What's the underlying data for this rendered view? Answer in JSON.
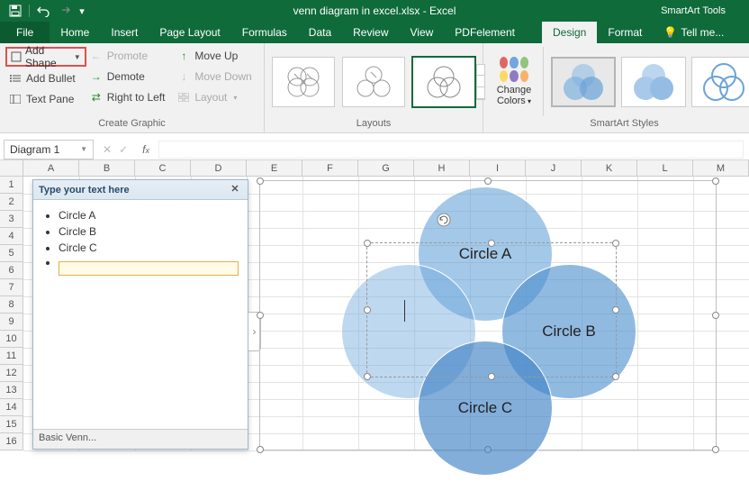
{
  "titlebar": {
    "doc_title": "venn diagram in excel.xlsx - Excel",
    "tool_context": "SmartArt Tools"
  },
  "tabs": {
    "file": "File",
    "items": [
      "Home",
      "Insert",
      "Page Layout",
      "Formulas",
      "Data",
      "Review",
      "View",
      "PDFelement"
    ],
    "design": "Design",
    "format": "Format",
    "tell": "Tell me..."
  },
  "ribbon": {
    "create": {
      "add_shape": "Add Shape",
      "add_bullet": "Add Bullet",
      "text_pane": "Text Pane",
      "promote": "Promote",
      "demote": "Demote",
      "right_to_left": "Right to Left",
      "move_up": "Move Up",
      "move_down": "Move Down",
      "layout": "Layout",
      "label": "Create Graphic"
    },
    "layouts_label": "Layouts",
    "colors": {
      "label1": "Change",
      "label2": "Colors"
    },
    "styles_label": "SmartArt Styles"
  },
  "namebox": "Diagram 1",
  "columns": [
    "A",
    "B",
    "C",
    "D",
    "E",
    "F",
    "G",
    "H",
    "I",
    "J",
    "K",
    "L",
    "M"
  ],
  "rows": [
    "1",
    "2",
    "3",
    "4",
    "5",
    "6",
    "7",
    "8",
    "9",
    "10",
    "11",
    "12",
    "13",
    "14",
    "15",
    "16"
  ],
  "textpane": {
    "title": "Type your text here",
    "items": [
      "Circle A",
      "Circle B",
      "Circle C"
    ],
    "footer": "Basic Venn..."
  },
  "venn": {
    "a": "Circle A",
    "b": "Circle B",
    "c": "Circle C"
  },
  "chart_data": {
    "type": "venn",
    "title": "Basic Venn",
    "sets": [
      {
        "name": "Circle A"
      },
      {
        "name": "Circle B"
      },
      {
        "name": "Circle C"
      },
      {
        "name": ""
      }
    ]
  }
}
